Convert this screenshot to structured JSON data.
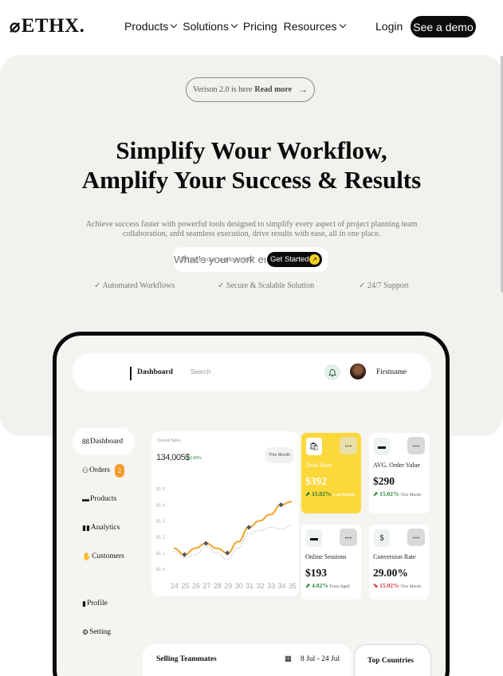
{
  "nav": {
    "logo_mark": "⌀",
    "logo_text": "ETHX.",
    "menu": [
      {
        "label": "Products",
        "dropdown": true
      },
      {
        "label": "Solutions",
        "dropdown": true
      },
      {
        "label": "Pricing",
        "dropdown": false
      },
      {
        "label": "Resources",
        "dropdown": true
      }
    ],
    "login_label": "Login",
    "demo_label": "See a demo"
  },
  "hero": {
    "badge_text": "Verison 2.0 is here",
    "badge_link": "Read more",
    "badge_arrow": "→",
    "headline_line1": "Simplify Wour Workflow,",
    "headline_line2": "Amplify Your Success & Results",
    "subtext": "Achieve success faster with powerful tools designed to simplify every aspect of project planning team collaboration, anfd seamless execution, drive results with ease, all in one place.",
    "email_placeholder": "What's your work email?",
    "cta_label": "Get Started",
    "features": [
      "✓ Automated Workflows",
      "✓ Secure & Scalable Solution",
      "✓ 24/7 Support"
    ]
  },
  "dashboard": {
    "topbar": {
      "title": "Dashboard",
      "search_placeholder": "Search",
      "user_name": "Firstname"
    },
    "sidebar": [
      {
        "icon": "88",
        "label": "Dashboard",
        "active": true
      },
      {
        "icon": "⚇",
        "label": "Orders",
        "badge": "2"
      },
      {
        "icon": "▬",
        "label": "Products"
      },
      {
        "icon": "▮▮",
        "label": "Analytics"
      },
      {
        "icon": "✋",
        "label": "Customers"
      },
      {
        "icon": "▮",
        "label": "Profile"
      },
      {
        "icon": "⚙",
        "label": "Setting"
      }
    ],
    "sales_chart": {
      "label": "Overall Sales",
      "value": "134,005$",
      "change": "↗ 13.80%",
      "period": "This Month"
    },
    "cards": [
      {
        "title": "Total Save",
        "value": "$392",
        "change": "15.02%",
        "period": "Last Month",
        "icon": "🛍",
        "variant": "yellow"
      },
      {
        "title": "AVG. Order Value",
        "value": "$290",
        "change": "15.02%",
        "period": "This Month",
        "icon": "▬"
      },
      {
        "title": "Online Sessions",
        "value": "$193",
        "change": "4.02%",
        "period": "From Agell",
        "icon": "▬"
      },
      {
        "title": "Conversion Rate",
        "value": "29.00%",
        "change": "15.02%",
        "period": "This Month",
        "icon": "$",
        "negative": true
      }
    ],
    "teammates": {
      "title": "Selling Teammates",
      "range": "8 Jul - 24 Jul"
    },
    "countries": {
      "title": "Top Countries"
    }
  },
  "chart_data": {
    "type": "line",
    "x": [
      24,
      25,
      26,
      27,
      28,
      29,
      30,
      31,
      32,
      33,
      34,
      35
    ],
    "x_tick_labels": [
      "24",
      "25",
      "26",
      "27",
      "28",
      "29",
      "30",
      "31",
      "32",
      "33",
      "34",
      "35"
    ],
    "y_tick_labels": [
      "$1.5",
      "$1.4",
      "$1.3",
      "$1.2",
      "$1.1",
      "$1.0"
    ],
    "ylim": [
      0.95,
      1.55
    ],
    "series": [
      {
        "values": [
          1.13,
          1.09,
          1.13,
          1.16,
          1.13,
          1.1,
          1.17,
          1.26,
          1.3,
          1.34,
          1.4,
          1.42
        ],
        "color": "#f1a93a"
      },
      {
        "values": [
          1.11,
          1.07,
          1.09,
          1.14,
          1.1,
          1.06,
          1.13,
          1.22,
          1.24,
          1.26,
          1.25,
          1.27
        ],
        "color": "#bbbbbb",
        "dashed": true
      }
    ],
    "markers": [
      {
        "x": 25,
        "y": 1.09
      },
      {
        "x": 27,
        "y": 1.16
      },
      {
        "x": 29,
        "y": 1.1
      },
      {
        "x": 31,
        "y": 1.26
      },
      {
        "x": 34,
        "y": 1.4
      }
    ],
    "grid": false
  }
}
